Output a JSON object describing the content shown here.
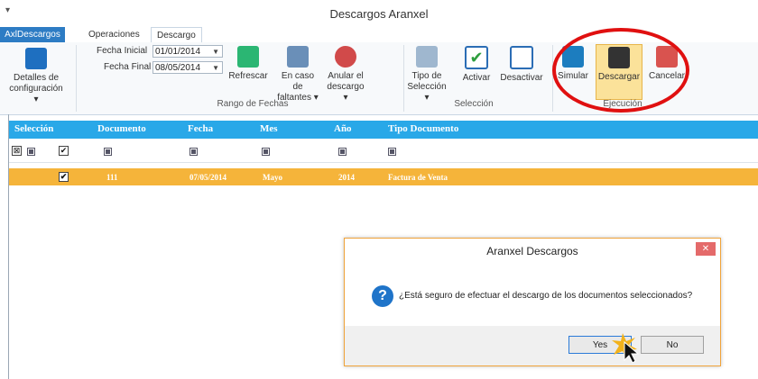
{
  "window": {
    "title": "Descargos Aranxel",
    "quick_access": "▾"
  },
  "tabs": {
    "app": "AxlDescargos",
    "operaciones": "Operaciones",
    "descargo": "Descargo"
  },
  "ribbon": {
    "detalles": "Detalles de configuración ▾",
    "fecha_inicial_label": "Fecha Inicial",
    "fecha_inicial_value": "01/01/2014",
    "fecha_final_label": "Fecha Final",
    "fecha_final_value": "08/05/2014",
    "refrescar": "Refrescar",
    "en_caso": "En caso de faltantes ▾",
    "anular": "Anular el descargo ▾",
    "rango_group": "Rango de Fechas",
    "tipo_seleccion": "Tipo de Selección ▾",
    "activar": "Activar",
    "desactivar": "Desactivar",
    "seleccion_group": "Selección",
    "simular": "Simular",
    "descargar": "Descargar",
    "cancelar": "Cancelar",
    "ejecucion_group": "Ejecución"
  },
  "grid": {
    "headers": [
      "Selección",
      "Documento",
      "Fecha",
      "Mes",
      "Año",
      "Tipo Documento"
    ],
    "row": {
      "documento": "111",
      "fecha": "07/05/2014",
      "mes": "Mayo",
      "anio": "2014",
      "tipo": "Factura de Venta"
    }
  },
  "dialog": {
    "title": "Aranxel Descargos",
    "close": "✕",
    "message": "¿Está seguro de efectuar el descargo de los documentos seleccionados?",
    "yes": "Yes",
    "no": "No"
  },
  "colors": {
    "accent": "#2d7cc4",
    "header": "#29a8e8",
    "selected_row": "#f5b43a",
    "highlight": "#e01010"
  }
}
